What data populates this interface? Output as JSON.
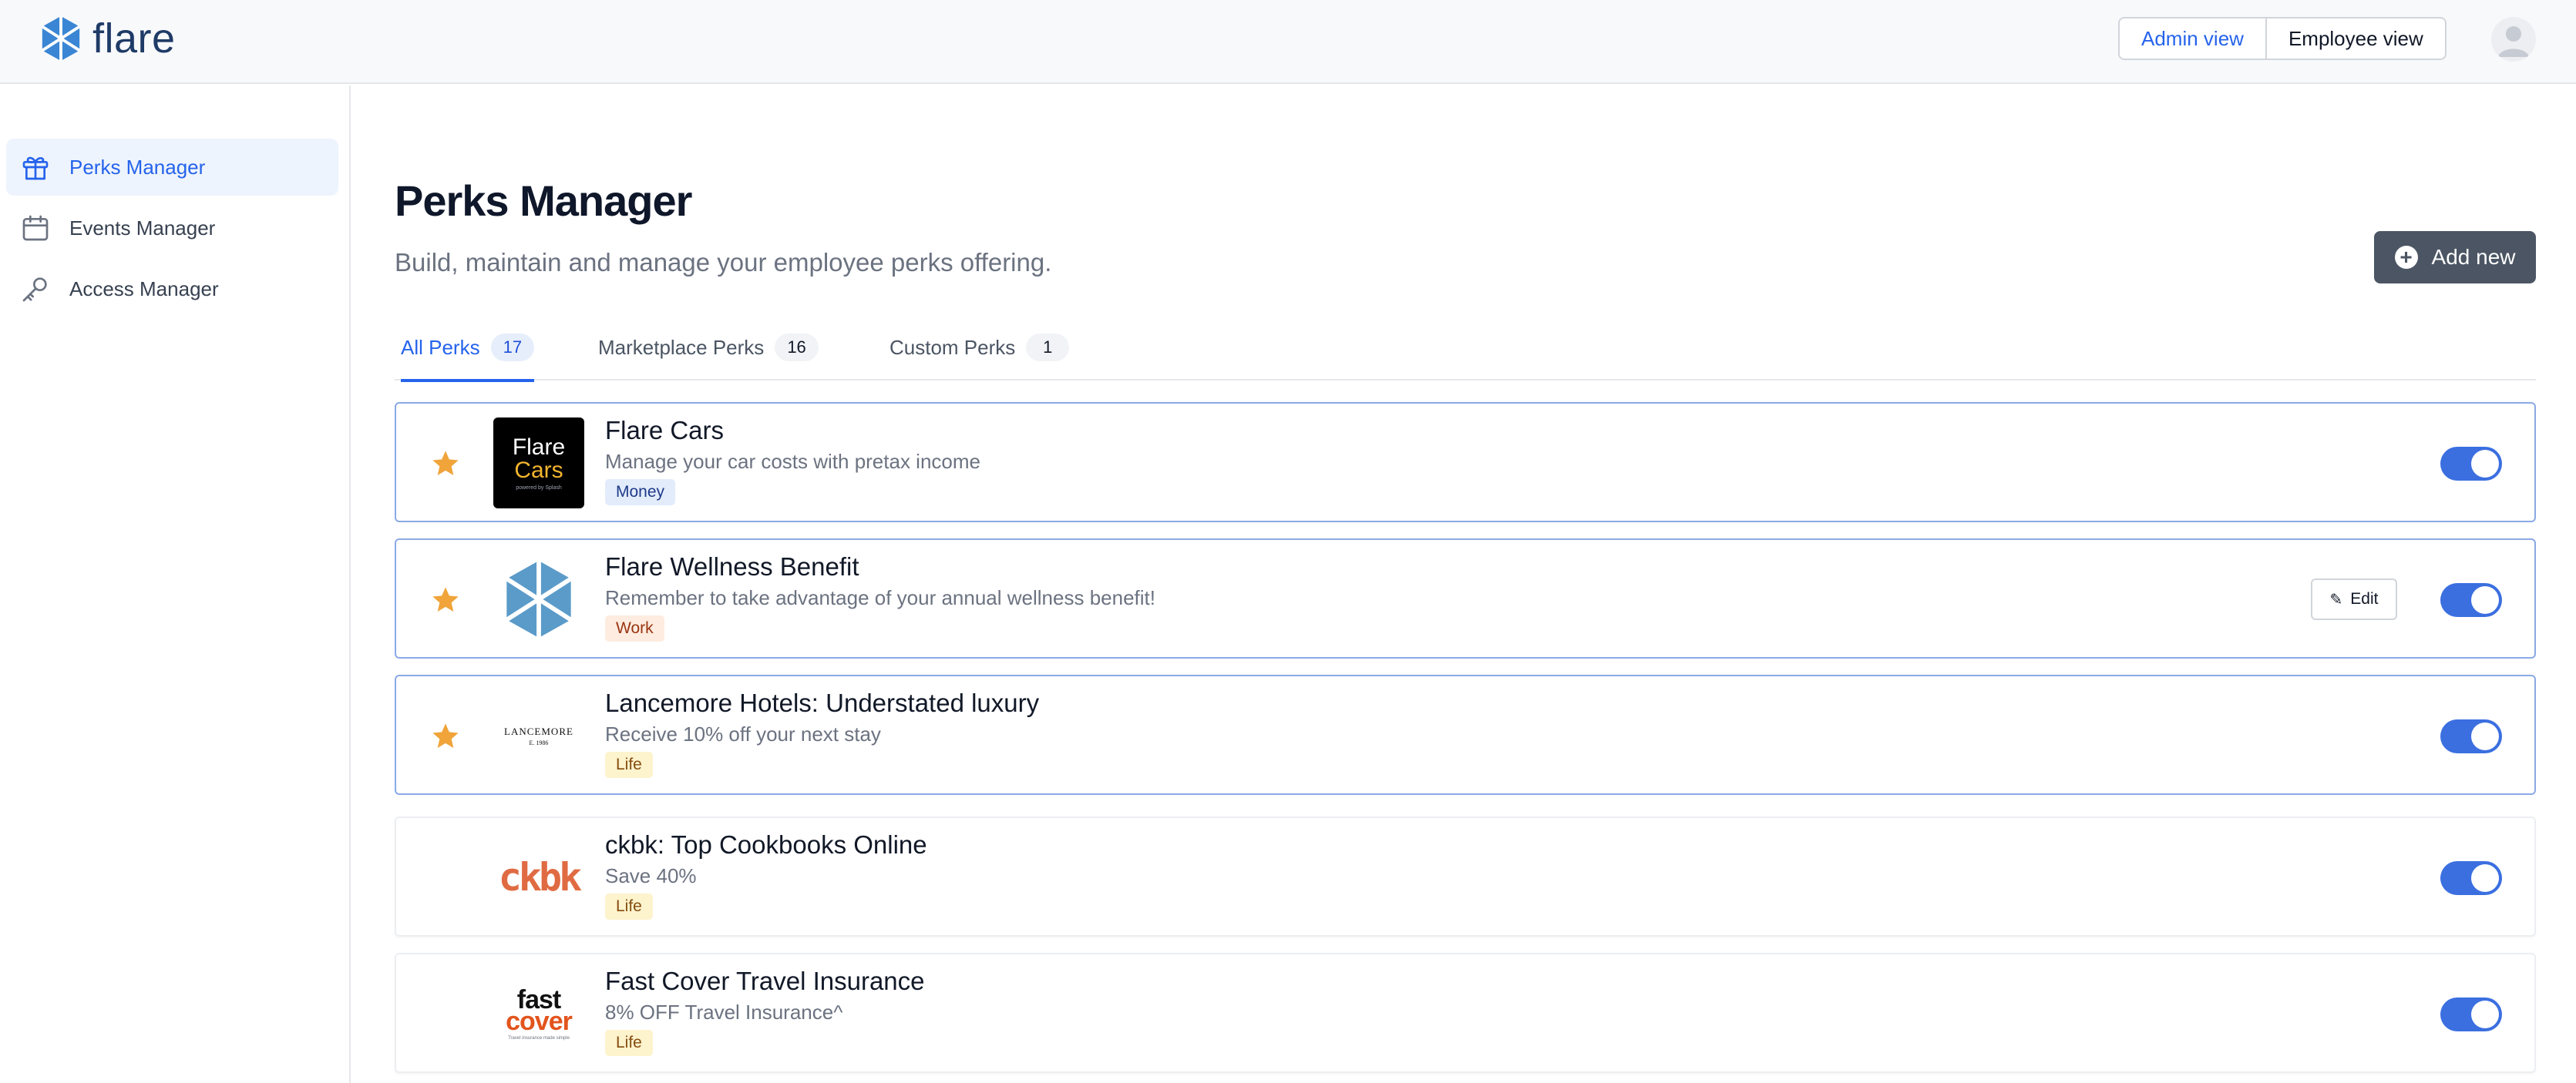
{
  "header": {
    "logo_text": "flare",
    "admin_view_label": "Admin view",
    "employee_view_label": "Employee view"
  },
  "sidebar": {
    "items": [
      {
        "label": "Perks Manager",
        "icon": "gift-icon",
        "active": true
      },
      {
        "label": "Events Manager",
        "icon": "calendar-icon",
        "active": false
      },
      {
        "label": "Access Manager",
        "icon": "key-icon",
        "active": false
      }
    ]
  },
  "main": {
    "title": "Perks Manager",
    "subtitle": "Build, maintain and manage your employee perks offering.",
    "add_new_label": "Add new",
    "tabs": [
      {
        "label": "All Perks",
        "count": "17",
        "active": true
      },
      {
        "label": "Marketplace Perks",
        "count": "16",
        "active": false
      },
      {
        "label": "Custom Perks",
        "count": "1",
        "active": false
      }
    ],
    "edit_label": "Edit",
    "perks": [
      {
        "title": "Flare Cars",
        "description": "Manage your car costs with pretax income",
        "tag": "Money",
        "featured": true,
        "enabled": true,
        "logo": {
          "line1": "Flare",
          "line2": "Cars",
          "line3": "powered by Splash"
        }
      },
      {
        "title": "Flare Wellness Benefit",
        "description": "Remember to take advantage of your annual wellness benefit!",
        "tag": "Work",
        "featured": true,
        "enabled": true,
        "editable": true
      },
      {
        "title": "Lancemore Hotels: Understated luxury",
        "description": "Receive 10% off your next stay",
        "tag": "Life",
        "featured": true,
        "enabled": true,
        "logo": {
          "line1": "LANCEMORE",
          "line2": "E. 1986"
        }
      },
      {
        "title": "ckbk: Top Cookbooks Online",
        "description": "Save 40%",
        "tag": "Life",
        "featured": false,
        "enabled": true,
        "logo": {
          "line1": "ckbk"
        }
      },
      {
        "title": "Fast Cover Travel Insurance",
        "description": "8% OFF Travel Insurance^",
        "tag": "Life",
        "featured": false,
        "enabled": true,
        "logo": {
          "line1": "fast",
          "line2": "cover",
          "line3": "Travel insurance made simple"
        }
      }
    ]
  },
  "colors": {
    "accent": "#2563eb",
    "star": "#f0a43a",
    "toggle_on": "#3b6fe0",
    "logo_blue": "#2f74c0"
  }
}
